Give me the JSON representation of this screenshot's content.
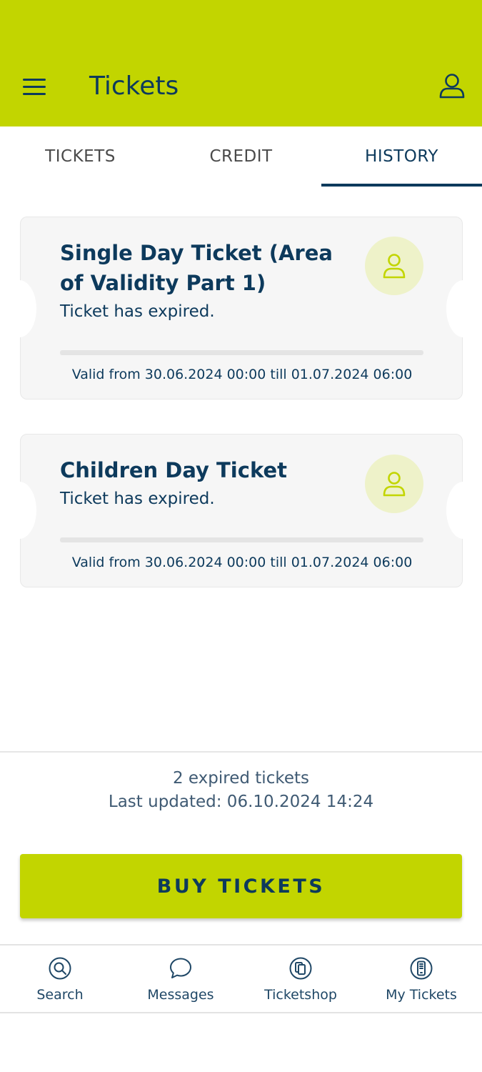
{
  "header": {
    "title": "Tickets",
    "menu_icon": "hamburger-menu-icon",
    "profile_icon": "user-icon"
  },
  "tabs": [
    {
      "label": "TICKETS",
      "active": false
    },
    {
      "label": "CREDIT",
      "active": false
    },
    {
      "label": "HISTORY",
      "active": true
    }
  ],
  "tickets": [
    {
      "title": "Single Day Ticket (Area of Validity Part 1)",
      "status": "Ticket has expired.",
      "validity": "Valid from 30.06.2024 00:00 till 01.07.2024 06:00",
      "icon": "person-icon"
    },
    {
      "title": "Children Day Ticket",
      "status": "Ticket has expired.",
      "validity": "Valid from 30.06.2024 00:00 till 01.07.2024 06:00",
      "icon": "person-icon"
    }
  ],
  "summary": {
    "count_text": "2 expired tickets",
    "updated_text": "Last updated: 06.10.2024 14:24"
  },
  "buy_button": {
    "label": "BUY TICKETS"
  },
  "bottom_nav": [
    {
      "label": "Search",
      "icon": "search-icon"
    },
    {
      "label": "Messages",
      "icon": "chat-bubble-icon"
    },
    {
      "label": "Ticketshop",
      "icon": "ticketshop-icon"
    },
    {
      "label": "My Tickets",
      "icon": "phone-ticket-icon"
    }
  ],
  "colors": {
    "brand": "#c2d500",
    "text_primary": "#0d3a5c",
    "card_bg": "#f6f6f6",
    "avatar_bg": "#eef2c9"
  }
}
